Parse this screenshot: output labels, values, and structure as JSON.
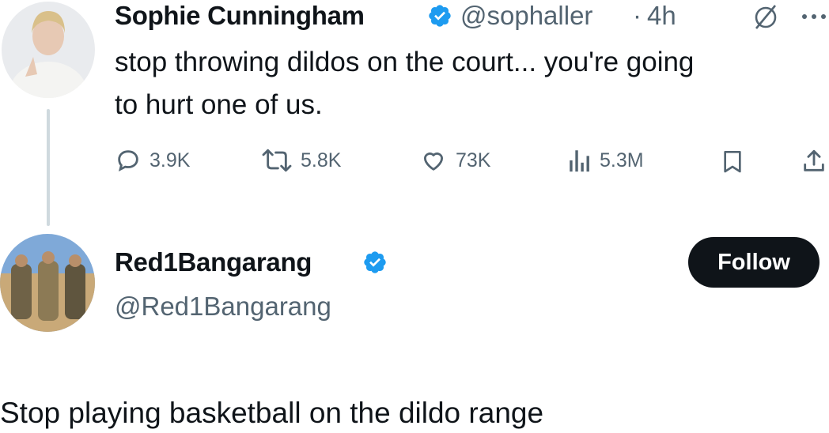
{
  "tweet": {
    "author_name": "Sophie Cunningham",
    "handle": "@sophaller",
    "separator": "·",
    "time": "4h",
    "text_line1": "stop throwing dildos on the court... you're going",
    "text_line2": "to hurt one of us.",
    "stats": {
      "replies": "3.9K",
      "reposts": "5.8K",
      "likes": "73K",
      "views": "5.3M"
    },
    "more_icon": "ellipsis-icon",
    "grok_icon": "slash-circle-icon"
  },
  "reply": {
    "author_name": "Red1Bangarang",
    "handle": "@Red1Bangarang",
    "follow_label": "Follow",
    "text": "Stop playing basketball on the dildo range"
  },
  "colors": {
    "verified": "#1d9bf0",
    "secondary_text": "#536471",
    "primary_text": "#0f1419",
    "follow_bg": "#0f1419"
  }
}
